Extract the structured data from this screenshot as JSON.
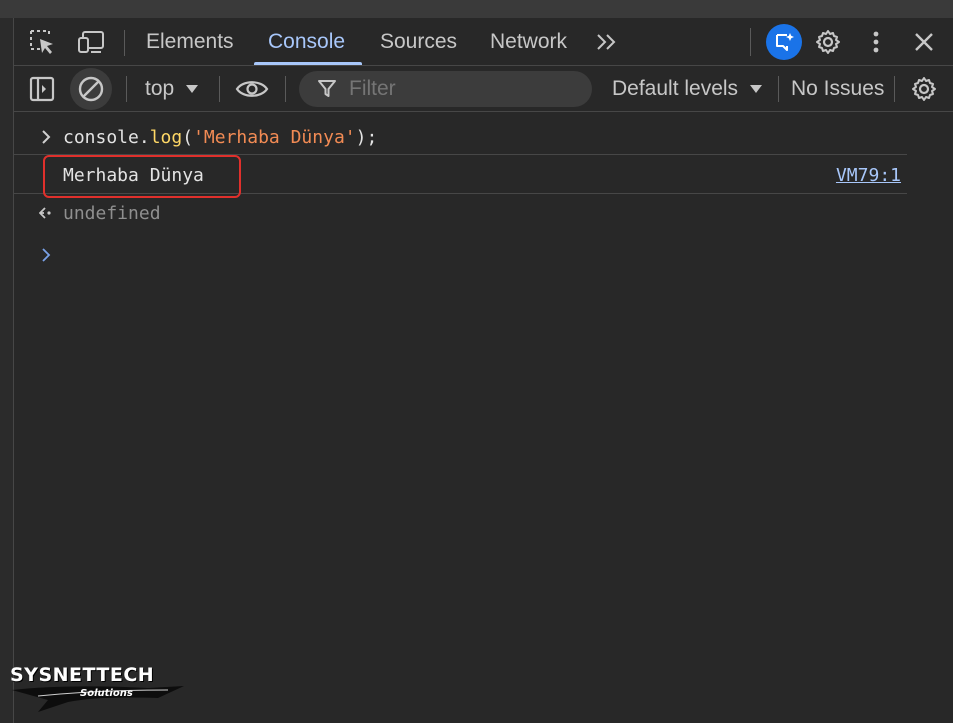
{
  "tabs": {
    "inspect_icon": "select-element-icon",
    "device_icon": "device-toolbar-icon",
    "items": [
      {
        "label": "Elements"
      },
      {
        "label": "Console"
      },
      {
        "label": "Sources"
      },
      {
        "label": "Network"
      }
    ],
    "active": "Console",
    "more_tabs_icon": "double-chevron-right-icon",
    "ai_assist_icon": "ai-assistance-icon",
    "settings_icon": "gear-icon",
    "menu_icon": "kebab-menu-icon",
    "close_icon": "close-icon"
  },
  "toolbar": {
    "sidebar_icon": "sidebar-toggle-icon",
    "clear_icon": "clear-console-icon",
    "context": "top",
    "eye_icon": "eye-icon",
    "filter_icon": "funnel-icon",
    "filter_placeholder": "Filter",
    "filter_value": "",
    "levels": "Default levels",
    "issues": "No Issues",
    "settings_icon": "gear-icon"
  },
  "console": {
    "input": {
      "obj": "console",
      "dot": ".",
      "method": "log",
      "open": "(",
      "string": "'Merhaba Dünya'",
      "close": ");"
    },
    "output": {
      "text": "Merhaba Dünya",
      "source": "VM79:1"
    },
    "result": "undefined"
  },
  "watermark": {
    "title": "SYSNETTECH",
    "subtitle": "Solutions"
  },
  "colors": {
    "background": "#282828",
    "accent": "#a8c7fa",
    "highlight_border": "#e0302c",
    "ai_button": "#1a73e8",
    "string": "#f28b54",
    "function": "#ffd866"
  }
}
